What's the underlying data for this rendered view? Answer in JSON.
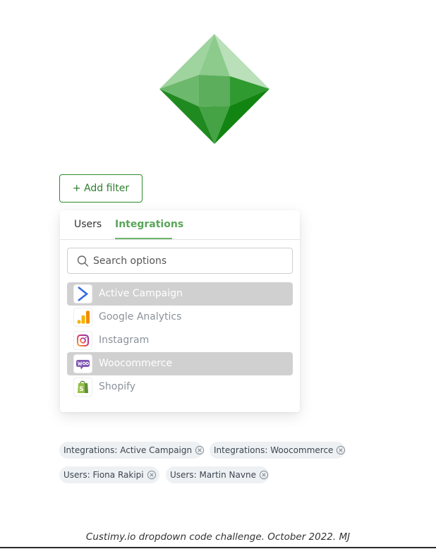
{
  "header": {
    "logo_icon": "green-octahedron-gem-icon"
  },
  "add_filter": {
    "label": "+ Add filter"
  },
  "dropdown": {
    "tabs": [
      {
        "label": "Users",
        "active": false
      },
      {
        "label": "Integrations",
        "active": true
      }
    ],
    "search": {
      "placeholder": "Search options",
      "value": ""
    },
    "options": [
      {
        "label": "Active Campaign",
        "icon": "active-campaign-icon",
        "selected": true
      },
      {
        "label": "Google Analytics",
        "icon": "google-analytics-icon",
        "selected": false
      },
      {
        "label": "Instagram",
        "icon": "instagram-icon",
        "selected": false
      },
      {
        "label": "Woocommerce",
        "icon": "woocommerce-icon",
        "selected": true
      },
      {
        "label": "Shopify",
        "icon": "shopify-icon",
        "selected": false
      }
    ]
  },
  "chips": [
    {
      "label": "Integrations: Active Campaign"
    },
    {
      "label": "Integrations: Woocommerce"
    },
    {
      "label": "Users: Fiona Rakipi"
    },
    {
      "label": "Users: Martin Navne"
    }
  ],
  "colors": {
    "accent": "#2f8a2f",
    "tab_active": "#5aa55a",
    "selected_row": "#d0d0d0",
    "chip_bg": "#eef1f3"
  },
  "footer": {
    "text": "Custimy.io dropdown code challenge. October 2022. MJ"
  }
}
